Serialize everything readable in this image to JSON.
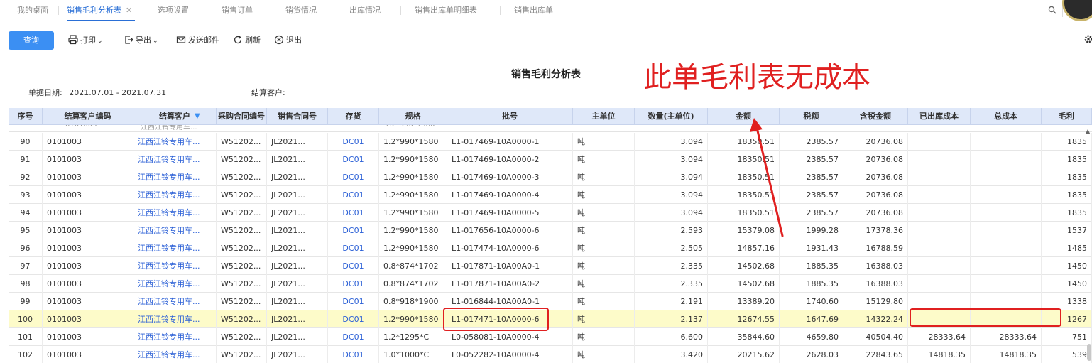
{
  "tabs": [
    {
      "label": "我的桌面",
      "active": false,
      "closable": false
    },
    {
      "label": "销售毛利分析表",
      "active": true,
      "closable": true
    },
    {
      "label": "选项设置",
      "active": false,
      "closable": false
    },
    {
      "label": "销售订单",
      "active": false,
      "closable": false
    },
    {
      "label": "销货情况",
      "active": false,
      "closable": false
    },
    {
      "label": "出库情况",
      "active": false,
      "closable": false
    },
    {
      "label": "销售出库单明细表",
      "active": false,
      "closable": false
    },
    {
      "label": "销售出库单",
      "active": false,
      "closable": false
    }
  ],
  "toolbar": {
    "query": "查询",
    "print": "打印",
    "export": "导出",
    "email": "发送邮件",
    "refresh": "刷新",
    "exit": "退出"
  },
  "report": {
    "title": "销售毛利分析表",
    "date_label": "单据日期:",
    "date_value": "2021.07.01 - 2021.07.31",
    "customer_label": "结算客户:"
  },
  "annotation": "此单毛利表无成本",
  "columns": [
    "序号",
    "结算客户编码",
    "结算客户",
    "采购合同编号",
    "销售合同号",
    "存货",
    "规格",
    "批号",
    "主单位",
    "数量(主单位)",
    "金额",
    "税额",
    "含税金额",
    "已出库成本",
    "总成本",
    "毛利"
  ],
  "rows": [
    {
      "seq": "90",
      "code": "0101003",
      "customer": "江西江铃专用车...",
      "pur": "W51202...",
      "sale": "JL2021...",
      "inv": "DC01",
      "spec": "1.2*990*1580",
      "batch": "L1-017469-10A0000-1",
      "unit": "吨",
      "qty": "3.094",
      "amount": "18350.51",
      "tax": "2385.57",
      "total": "20736.08",
      "out_cost": "",
      "cost": "",
      "profit": "1835"
    },
    {
      "seq": "91",
      "code": "0101003",
      "customer": "江西江铃专用车...",
      "pur": "W51202...",
      "sale": "JL2021...",
      "inv": "DC01",
      "spec": "1.2*990*1580",
      "batch": "L1-017469-10A0000-2",
      "unit": "吨",
      "qty": "3.094",
      "amount": "18350.51",
      "tax": "2385.57",
      "total": "20736.08",
      "out_cost": "",
      "cost": "",
      "profit": "1835"
    },
    {
      "seq": "92",
      "code": "0101003",
      "customer": "江西江铃专用车...",
      "pur": "W51202...",
      "sale": "JL2021...",
      "inv": "DC01",
      "spec": "1.2*990*1580",
      "batch": "L1-017469-10A0000-3",
      "unit": "吨",
      "qty": "3.094",
      "amount": "18350.51",
      "tax": "2385.57",
      "total": "20736.08",
      "out_cost": "",
      "cost": "",
      "profit": "1835"
    },
    {
      "seq": "93",
      "code": "0101003",
      "customer": "江西江铃专用车...",
      "pur": "W51202...",
      "sale": "JL2021...",
      "inv": "DC01",
      "spec": "1.2*990*1580",
      "batch": "L1-017469-10A0000-4",
      "unit": "吨",
      "qty": "3.094",
      "amount": "18350.51",
      "tax": "2385.57",
      "total": "20736.08",
      "out_cost": "",
      "cost": "",
      "profit": "1835"
    },
    {
      "seq": "94",
      "code": "0101003",
      "customer": "江西江铃专用车...",
      "pur": "W51202...",
      "sale": "JL2021...",
      "inv": "DC01",
      "spec": "1.2*990*1580",
      "batch": "L1-017469-10A0000-5",
      "unit": "吨",
      "qty": "3.094",
      "amount": "18350.51",
      "tax": "2385.57",
      "total": "20736.08",
      "out_cost": "",
      "cost": "",
      "profit": "1835"
    },
    {
      "seq": "95",
      "code": "0101003",
      "customer": "江西江铃专用车...",
      "pur": "W51202...",
      "sale": "JL2021...",
      "inv": "DC01",
      "spec": "1.2*990*1580",
      "batch": "L1-017656-10A0000-6",
      "unit": "吨",
      "qty": "2.593",
      "amount": "15379.08",
      "tax": "1999.28",
      "total": "17378.36",
      "out_cost": "",
      "cost": "",
      "profit": "1537"
    },
    {
      "seq": "96",
      "code": "0101003",
      "customer": "江西江铃专用车...",
      "pur": "W51202...",
      "sale": "JL2021...",
      "inv": "DC01",
      "spec": "1.2*990*1580",
      "batch": "L1-017474-10A0000-6",
      "unit": "吨",
      "qty": "2.505",
      "amount": "14857.16",
      "tax": "1931.43",
      "total": "16788.59",
      "out_cost": "",
      "cost": "",
      "profit": "1485"
    },
    {
      "seq": "97",
      "code": "0101003",
      "customer": "江西江铃专用车...",
      "pur": "W51202...",
      "sale": "JL2021...",
      "inv": "DC01",
      "spec": "0.8*874*1702",
      "batch": "L1-017871-10A00A0-1",
      "unit": "吨",
      "qty": "2.335",
      "amount": "14502.68",
      "tax": "1885.35",
      "total": "16388.03",
      "out_cost": "",
      "cost": "",
      "profit": "1450"
    },
    {
      "seq": "98",
      "code": "0101003",
      "customer": "江西江铃专用车...",
      "pur": "W51202...",
      "sale": "JL2021...",
      "inv": "DC01",
      "spec": "0.8*874*1702",
      "batch": "L1-017871-10A00A0-2",
      "unit": "吨",
      "qty": "2.335",
      "amount": "14502.68",
      "tax": "1885.35",
      "total": "16388.03",
      "out_cost": "",
      "cost": "",
      "profit": "1450"
    },
    {
      "seq": "99",
      "code": "0101003",
      "customer": "江西江铃专用车...",
      "pur": "W51202...",
      "sale": "JL2021...",
      "inv": "DC01",
      "spec": "0.8*918*1900",
      "batch": "L1-016844-10A00A0-1",
      "unit": "吨",
      "qty": "2.191",
      "amount": "13389.20",
      "tax": "1740.60",
      "total": "15129.80",
      "out_cost": "",
      "cost": "",
      "profit": "1338"
    },
    {
      "seq": "100",
      "code": "0101003",
      "customer": "江西江铃专用车...",
      "pur": "W51202...",
      "sale": "JL2021...",
      "inv": "DC01",
      "spec": "1.2*990*1580",
      "batch": "L1-017471-10A0000-6",
      "unit": "吨",
      "qty": "2.137",
      "amount": "12674.55",
      "tax": "1647.69",
      "total": "14322.24",
      "out_cost": "",
      "cost": "",
      "profit": "1267",
      "highlight": true
    },
    {
      "seq": "101",
      "code": "0101003",
      "customer": "江西江铃专用车...",
      "pur": "W51202...",
      "sale": "JL2021...",
      "inv": "DC01",
      "spec": "1.2*1295*C",
      "batch": "L0-058081-10A0000-4",
      "unit": "吨",
      "qty": "6.600",
      "amount": "35844.60",
      "tax": "4659.80",
      "total": "40504.40",
      "out_cost": "28333.64",
      "cost": "28333.64",
      "profit": "751"
    },
    {
      "seq": "102",
      "code": "0101003",
      "customer": "江西江铃专用车...",
      "pur": "W51202...",
      "sale": "JL2021...",
      "inv": "DC01",
      "spec": "1.0*1000*C",
      "batch": "L0-052282-10A0000-4",
      "unit": "吨",
      "qty": "3.420",
      "amount": "20215.62",
      "tax": "2628.03",
      "total": "22843.65",
      "out_cost": "14818.35",
      "cost": "14818.35",
      "profit": "539"
    }
  ],
  "colors": {
    "accent": "#3b8ff3",
    "link": "#2a5fd6",
    "annotation": "#e02020",
    "header_bg": "#dfe8f9",
    "highlight": "#fdfbc9"
  }
}
